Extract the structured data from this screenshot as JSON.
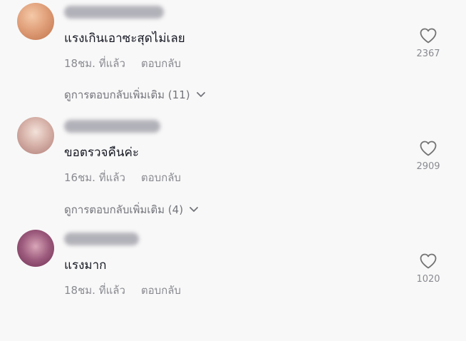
{
  "comments": [
    {
      "avatar_color": "#e0a07a",
      "username_color": "#9a9aa4",
      "text": "แรงเกินเอาซะสุดไม่เลย",
      "time": "18ชม. ที่แล้ว",
      "reply_label": "ตอบกลับ",
      "view_replies_label": "ดูการตอบกลับเพิ่มเติม (11)",
      "likes": "2367",
      "like_icon": "heart-outline-icon"
    },
    {
      "avatar_color": "#d7b3aa",
      "username_color": "#9a9aa4",
      "text": "ขอตรวจคืนค่ะ",
      "time": "16ชม. ที่แล้ว",
      "reply_label": "ตอบกลับ",
      "view_replies_label": "ดูการตอบกลับเพิ่มเติม (4)",
      "likes": "2909",
      "like_icon": "heart-outline-icon"
    },
    {
      "avatar_color": "#9c5a7c",
      "username_color": "#9a9aa4",
      "text": "แรงมาก",
      "time": "18ชม. ที่แล้ว",
      "reply_label": "ตอบกลับ",
      "likes": "1020",
      "like_icon": "heart-outline-icon"
    }
  ]
}
